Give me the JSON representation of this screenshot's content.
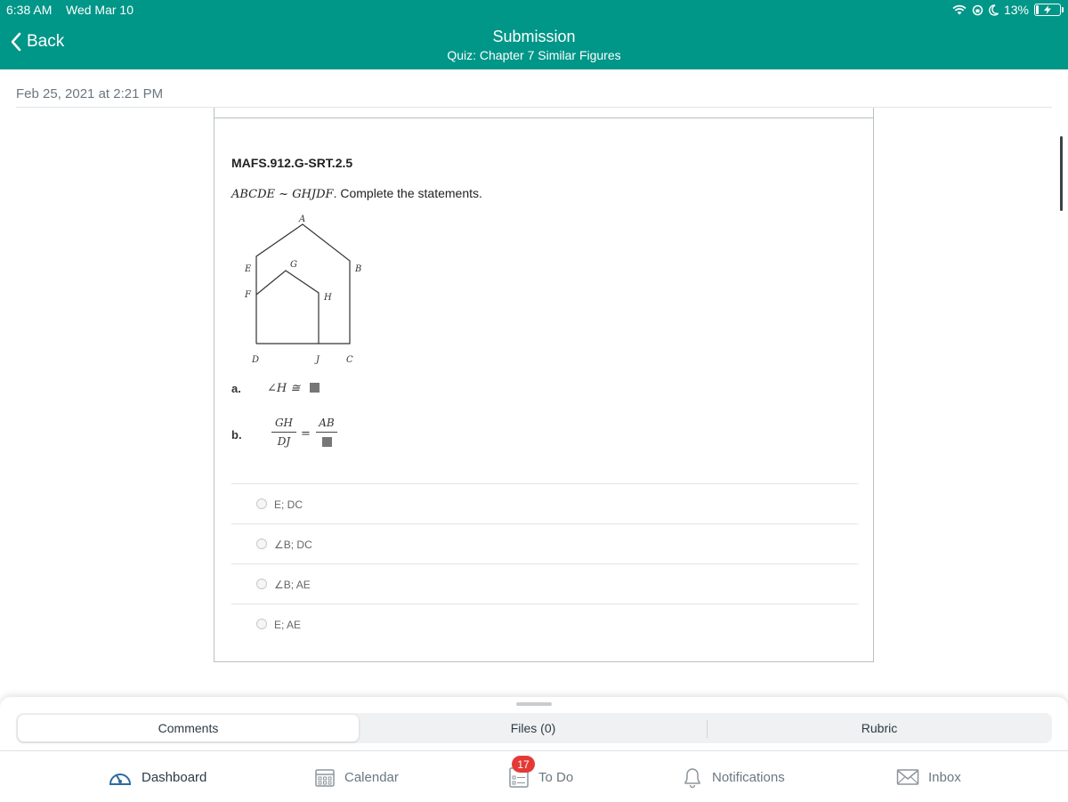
{
  "status_bar": {
    "time": "6:38 AM",
    "date": "Wed Mar 10",
    "battery_percent": "13%",
    "battery_level": 0.13
  },
  "nav": {
    "back_label": "Back",
    "title": "Submission",
    "subtitle": "Quiz: Chapter 7 Similar Figures"
  },
  "submission": {
    "timestamp": "Feb 25, 2021 at 2:21 PM"
  },
  "question": {
    "standard": "MAFS.912.G-SRT.2.5",
    "similarity": "ABCDE ~ GHJDF",
    "prompt_text": ". Complete the statements.",
    "figure_labels": {
      "A": "A",
      "B": "B",
      "C": "C",
      "D": "D",
      "E": "E",
      "F": "F",
      "G": "G",
      "H": "H",
      "J": "J"
    },
    "part_a": {
      "label": "a.",
      "expression": "∠H ≅"
    },
    "part_b": {
      "label": "b.",
      "left_num": "GH",
      "left_den": "DJ",
      "equals": "=",
      "right_num": "AB"
    },
    "options": [
      {
        "text": "E; DC"
      },
      {
        "text": "∠B; DC"
      },
      {
        "text": "∠B; AE"
      },
      {
        "text": "E; AE"
      }
    ]
  },
  "bottom_sheet": {
    "tabs": [
      {
        "label": "Comments",
        "active": true
      },
      {
        "label": "Files (0)",
        "active": false
      },
      {
        "label": "Rubric",
        "active": false
      }
    ]
  },
  "tab_bar": {
    "items": [
      {
        "label": "Dashboard",
        "icon": "dashboard-icon",
        "active": true
      },
      {
        "label": "Calendar",
        "icon": "calendar-icon",
        "active": false
      },
      {
        "label": "To Do",
        "icon": "todo-icon",
        "active": false,
        "badge": "17"
      },
      {
        "label": "Notifications",
        "icon": "bell-icon",
        "active": false
      },
      {
        "label": "Inbox",
        "icon": "envelope-icon",
        "active": false
      }
    ]
  },
  "colors": {
    "brand": "#009688",
    "badge": "#e53935",
    "text": "#2d3b45",
    "muted": "#6b7780"
  }
}
